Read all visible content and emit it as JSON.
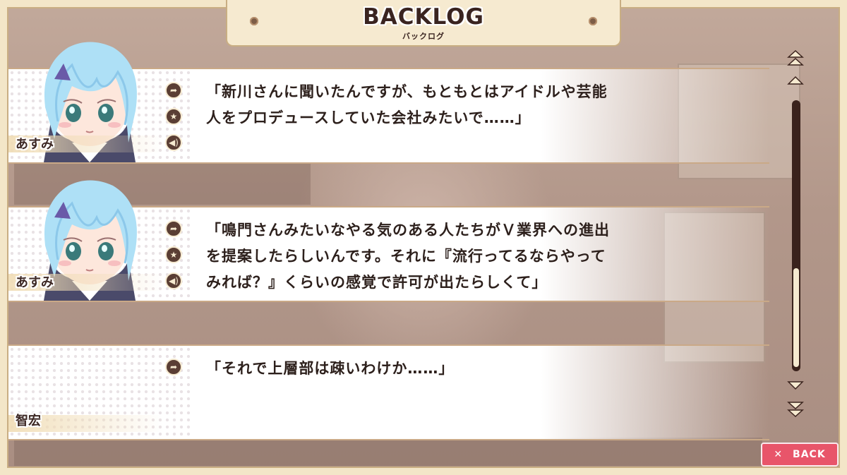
{
  "title": {
    "main": "BACKLOG",
    "sub": "バックログ"
  },
  "entries": [
    {
      "speaker": "あすみ",
      "lines": [
        "「新川さんに聞いたんですが、もともとはアイドルや芸能",
        "人をプロデュースしていた会社みたいで……」"
      ],
      "portrait": "azumi-portrait",
      "icons": [
        "jump-icon",
        "favorite-star-icon",
        "voice-replay-icon"
      ]
    },
    {
      "speaker": "あすみ",
      "lines": [
        "「鳴門さんみたいなやる気のある人たちがＶ業界への進出",
        "を提案したらしいんです。それに『流行ってるならやって",
        "みれば？』くらいの感覚で許可が出たらしくて」"
      ],
      "portrait": "azumi-portrait",
      "icons": [
        "jump-icon",
        "favorite-star-icon",
        "voice-replay-icon"
      ]
    },
    {
      "speaker": "智宏",
      "lines": [
        "「それで上層部は疎いわけか……」"
      ],
      "portrait": null,
      "icons": [
        "jump-icon"
      ]
    }
  ],
  "scrollbar": {
    "position": 0.88
  },
  "back_button": {
    "label": "BACK",
    "icon": "close-x-icon"
  },
  "colors": {
    "frame": "#f3e6c8",
    "accent_back": "#e8556a",
    "icon_bg": "#5a3e34",
    "text": "#2d201c"
  }
}
